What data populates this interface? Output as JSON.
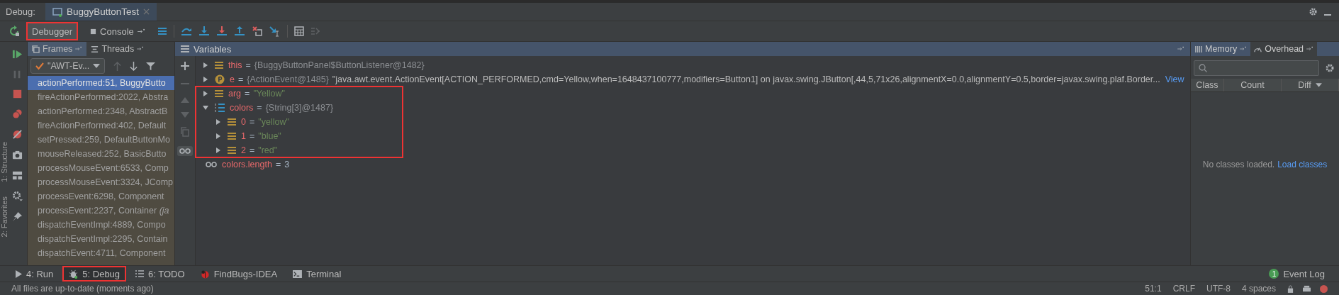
{
  "header": {
    "label": "Debug:",
    "tab": {
      "title": "BuggyButtonTest"
    }
  },
  "toolbar": {
    "tabs": [
      {
        "label": "Debugger",
        "selected": true,
        "annotated": true
      },
      {
        "label": "Console",
        "selected": false,
        "annotated": false
      }
    ]
  },
  "side_labels": [
    "1: Structure",
    "2: Favorites"
  ],
  "frames_panel": {
    "tabs": [
      {
        "label": "Frames",
        "selected": true
      },
      {
        "label": "Threads",
        "selected": false
      }
    ],
    "thread": "\"AWT-Ev...",
    "frames": [
      {
        "text": "actionPerformed:51, BuggyButto",
        "selected": true
      },
      {
        "text": "fireActionPerformed:2022, Abstra",
        "selected": false
      },
      {
        "text": "actionPerformed:2348, AbstractB",
        "selected": false
      },
      {
        "text": "fireActionPerformed:402, Default",
        "selected": false
      },
      {
        "text": "setPressed:259, DefaultButtonMo",
        "selected": false
      },
      {
        "text": "mouseReleased:252, BasicButto",
        "selected": false
      },
      {
        "text": "processMouseEvent:6533, Comp",
        "selected": false
      },
      {
        "text": "processMouseEvent:3324, JComp",
        "selected": false
      },
      {
        "text": "processEvent:6298, Component",
        "selected": false
      },
      {
        "text": "processEvent:2237, Container *(ja*",
        "selected": false
      },
      {
        "text": "dispatchEventImpl:4889, Compo",
        "selected": false
      },
      {
        "text": "dispatchEventImpl:2295, Contain",
        "selected": false
      },
      {
        "text": "dispatchEvent:4711, Component",
        "selected": false
      }
    ]
  },
  "variables": {
    "title": "Variables",
    "watches_toggle": {
      "selected": true
    },
    "items": [
      {
        "kind": "field",
        "name": "this",
        "operator": "=",
        "value": "{BuggyButtonPanel$ButtonListener@1482}",
        "color": "#8c8f93",
        "expanded": false,
        "annotated": false
      },
      {
        "kind": "param",
        "name": "e",
        "operator": "=",
        "value": "{ActionEvent@1485}",
        "detail": "\"java.awt.event.ActionEvent[ACTION_PERFORMED,cmd=Yellow,when=1648437100777,modifiers=Button1] on javax.swing.JButton[,44,5,71x26,alignmentX=0.0,alignmentY=0.5,border=javax.swing.plaf.Border...",
        "link": "View",
        "color": "#8c8f93",
        "expanded": false,
        "annotated": false
      },
      {
        "kind": "field",
        "name": "arg",
        "operator": "=",
        "value": "\"Yellow\"",
        "color": "#6a8759",
        "expanded": false,
        "annotated": true
      },
      {
        "kind": "array",
        "name": "colors",
        "operator": "=",
        "value": "{String[3]@1487}",
        "color": "#8c8f93",
        "expanded": true,
        "annotated": true,
        "children": [
          {
            "kind": "field",
            "name": "0",
            "operator": "=",
            "value": "\"yellow\"",
            "color": "#6a8759",
            "expanded": false
          },
          {
            "kind": "field",
            "name": "1",
            "operator": "=",
            "value": "\"blue\"",
            "color": "#6a8759",
            "expanded": false
          },
          {
            "kind": "field",
            "name": "2",
            "operator": "=",
            "value": "\"red\"",
            "color": "#6a8759",
            "expanded": false
          }
        ]
      }
    ],
    "watches": [
      {
        "name": "colors.length",
        "operator": "=",
        "value": "3"
      }
    ]
  },
  "memory_panel": {
    "tabs": [
      {
        "label": "Memory",
        "selected": false
      },
      {
        "label": "Overhead",
        "selected": true
      }
    ],
    "columns": [
      "Class",
      "Count",
      "Diff"
    ],
    "empty_text": "No classes loaded.",
    "link": "Load classes"
  },
  "tool_windows": [
    {
      "label": "4: Run",
      "kind": "run",
      "selected": false,
      "annotated": false
    },
    {
      "label": "5: Debug",
      "kind": "debug",
      "selected": true,
      "annotated": true
    },
    {
      "label": "6: TODO",
      "kind": "todo",
      "selected": false,
      "annotated": false
    },
    {
      "label": "FindBugs-IDEA",
      "kind": "bug",
      "selected": false,
      "annotated": false
    },
    {
      "label": "Terminal",
      "kind": "terminal",
      "selected": false,
      "annotated": false
    }
  ],
  "event_log": {
    "count": "1",
    "label": "Event Log"
  },
  "status_bar": {
    "message": "All files are up-to-date (moments ago)",
    "items": [
      "51:1",
      "CRLF",
      "UTF-8",
      "4 spaces"
    ]
  }
}
